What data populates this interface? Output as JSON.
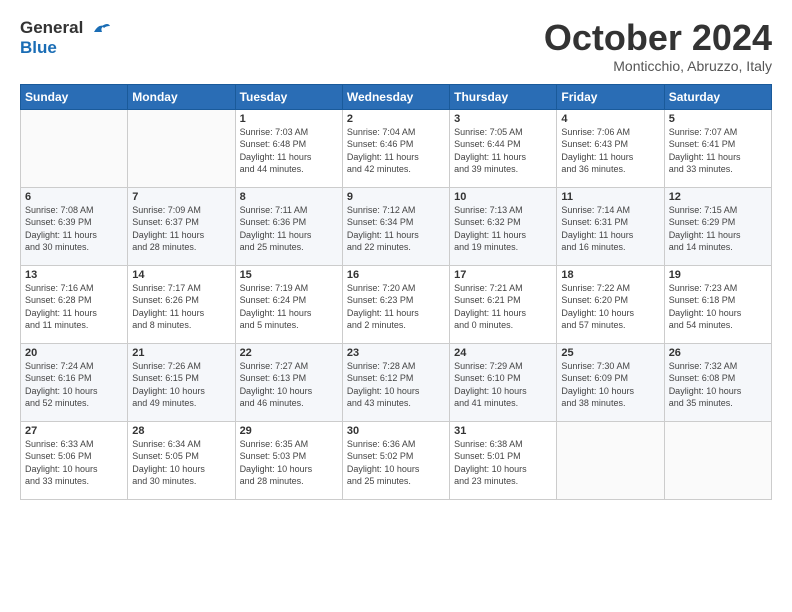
{
  "header": {
    "logo_line1": "General",
    "logo_line2": "Blue",
    "month": "October 2024",
    "location": "Monticchio, Abruzzo, Italy"
  },
  "weekdays": [
    "Sunday",
    "Monday",
    "Tuesday",
    "Wednesday",
    "Thursday",
    "Friday",
    "Saturday"
  ],
  "weeks": [
    [
      {
        "day": "",
        "info": ""
      },
      {
        "day": "",
        "info": ""
      },
      {
        "day": "1",
        "info": "Sunrise: 7:03 AM\nSunset: 6:48 PM\nDaylight: 11 hours\nand 44 minutes."
      },
      {
        "day": "2",
        "info": "Sunrise: 7:04 AM\nSunset: 6:46 PM\nDaylight: 11 hours\nand 42 minutes."
      },
      {
        "day": "3",
        "info": "Sunrise: 7:05 AM\nSunset: 6:44 PM\nDaylight: 11 hours\nand 39 minutes."
      },
      {
        "day": "4",
        "info": "Sunrise: 7:06 AM\nSunset: 6:43 PM\nDaylight: 11 hours\nand 36 minutes."
      },
      {
        "day": "5",
        "info": "Sunrise: 7:07 AM\nSunset: 6:41 PM\nDaylight: 11 hours\nand 33 minutes."
      }
    ],
    [
      {
        "day": "6",
        "info": "Sunrise: 7:08 AM\nSunset: 6:39 PM\nDaylight: 11 hours\nand 30 minutes."
      },
      {
        "day": "7",
        "info": "Sunrise: 7:09 AM\nSunset: 6:37 PM\nDaylight: 11 hours\nand 28 minutes."
      },
      {
        "day": "8",
        "info": "Sunrise: 7:11 AM\nSunset: 6:36 PM\nDaylight: 11 hours\nand 25 minutes."
      },
      {
        "day": "9",
        "info": "Sunrise: 7:12 AM\nSunset: 6:34 PM\nDaylight: 11 hours\nand 22 minutes."
      },
      {
        "day": "10",
        "info": "Sunrise: 7:13 AM\nSunset: 6:32 PM\nDaylight: 11 hours\nand 19 minutes."
      },
      {
        "day": "11",
        "info": "Sunrise: 7:14 AM\nSunset: 6:31 PM\nDaylight: 11 hours\nand 16 minutes."
      },
      {
        "day": "12",
        "info": "Sunrise: 7:15 AM\nSunset: 6:29 PM\nDaylight: 11 hours\nand 14 minutes."
      }
    ],
    [
      {
        "day": "13",
        "info": "Sunrise: 7:16 AM\nSunset: 6:28 PM\nDaylight: 11 hours\nand 11 minutes."
      },
      {
        "day": "14",
        "info": "Sunrise: 7:17 AM\nSunset: 6:26 PM\nDaylight: 11 hours\nand 8 minutes."
      },
      {
        "day": "15",
        "info": "Sunrise: 7:19 AM\nSunset: 6:24 PM\nDaylight: 11 hours\nand 5 minutes."
      },
      {
        "day": "16",
        "info": "Sunrise: 7:20 AM\nSunset: 6:23 PM\nDaylight: 11 hours\nand 2 minutes."
      },
      {
        "day": "17",
        "info": "Sunrise: 7:21 AM\nSunset: 6:21 PM\nDaylight: 11 hours\nand 0 minutes."
      },
      {
        "day": "18",
        "info": "Sunrise: 7:22 AM\nSunset: 6:20 PM\nDaylight: 10 hours\nand 57 minutes."
      },
      {
        "day": "19",
        "info": "Sunrise: 7:23 AM\nSunset: 6:18 PM\nDaylight: 10 hours\nand 54 minutes."
      }
    ],
    [
      {
        "day": "20",
        "info": "Sunrise: 7:24 AM\nSunset: 6:16 PM\nDaylight: 10 hours\nand 52 minutes."
      },
      {
        "day": "21",
        "info": "Sunrise: 7:26 AM\nSunset: 6:15 PM\nDaylight: 10 hours\nand 49 minutes."
      },
      {
        "day": "22",
        "info": "Sunrise: 7:27 AM\nSunset: 6:13 PM\nDaylight: 10 hours\nand 46 minutes."
      },
      {
        "day": "23",
        "info": "Sunrise: 7:28 AM\nSunset: 6:12 PM\nDaylight: 10 hours\nand 43 minutes."
      },
      {
        "day": "24",
        "info": "Sunrise: 7:29 AM\nSunset: 6:10 PM\nDaylight: 10 hours\nand 41 minutes."
      },
      {
        "day": "25",
        "info": "Sunrise: 7:30 AM\nSunset: 6:09 PM\nDaylight: 10 hours\nand 38 minutes."
      },
      {
        "day": "26",
        "info": "Sunrise: 7:32 AM\nSunset: 6:08 PM\nDaylight: 10 hours\nand 35 minutes."
      }
    ],
    [
      {
        "day": "27",
        "info": "Sunrise: 6:33 AM\nSunset: 5:06 PM\nDaylight: 10 hours\nand 33 minutes."
      },
      {
        "day": "28",
        "info": "Sunrise: 6:34 AM\nSunset: 5:05 PM\nDaylight: 10 hours\nand 30 minutes."
      },
      {
        "day": "29",
        "info": "Sunrise: 6:35 AM\nSunset: 5:03 PM\nDaylight: 10 hours\nand 28 minutes."
      },
      {
        "day": "30",
        "info": "Sunrise: 6:36 AM\nSunset: 5:02 PM\nDaylight: 10 hours\nand 25 minutes."
      },
      {
        "day": "31",
        "info": "Sunrise: 6:38 AM\nSunset: 5:01 PM\nDaylight: 10 hours\nand 23 minutes."
      },
      {
        "day": "",
        "info": ""
      },
      {
        "day": "",
        "info": ""
      }
    ]
  ]
}
